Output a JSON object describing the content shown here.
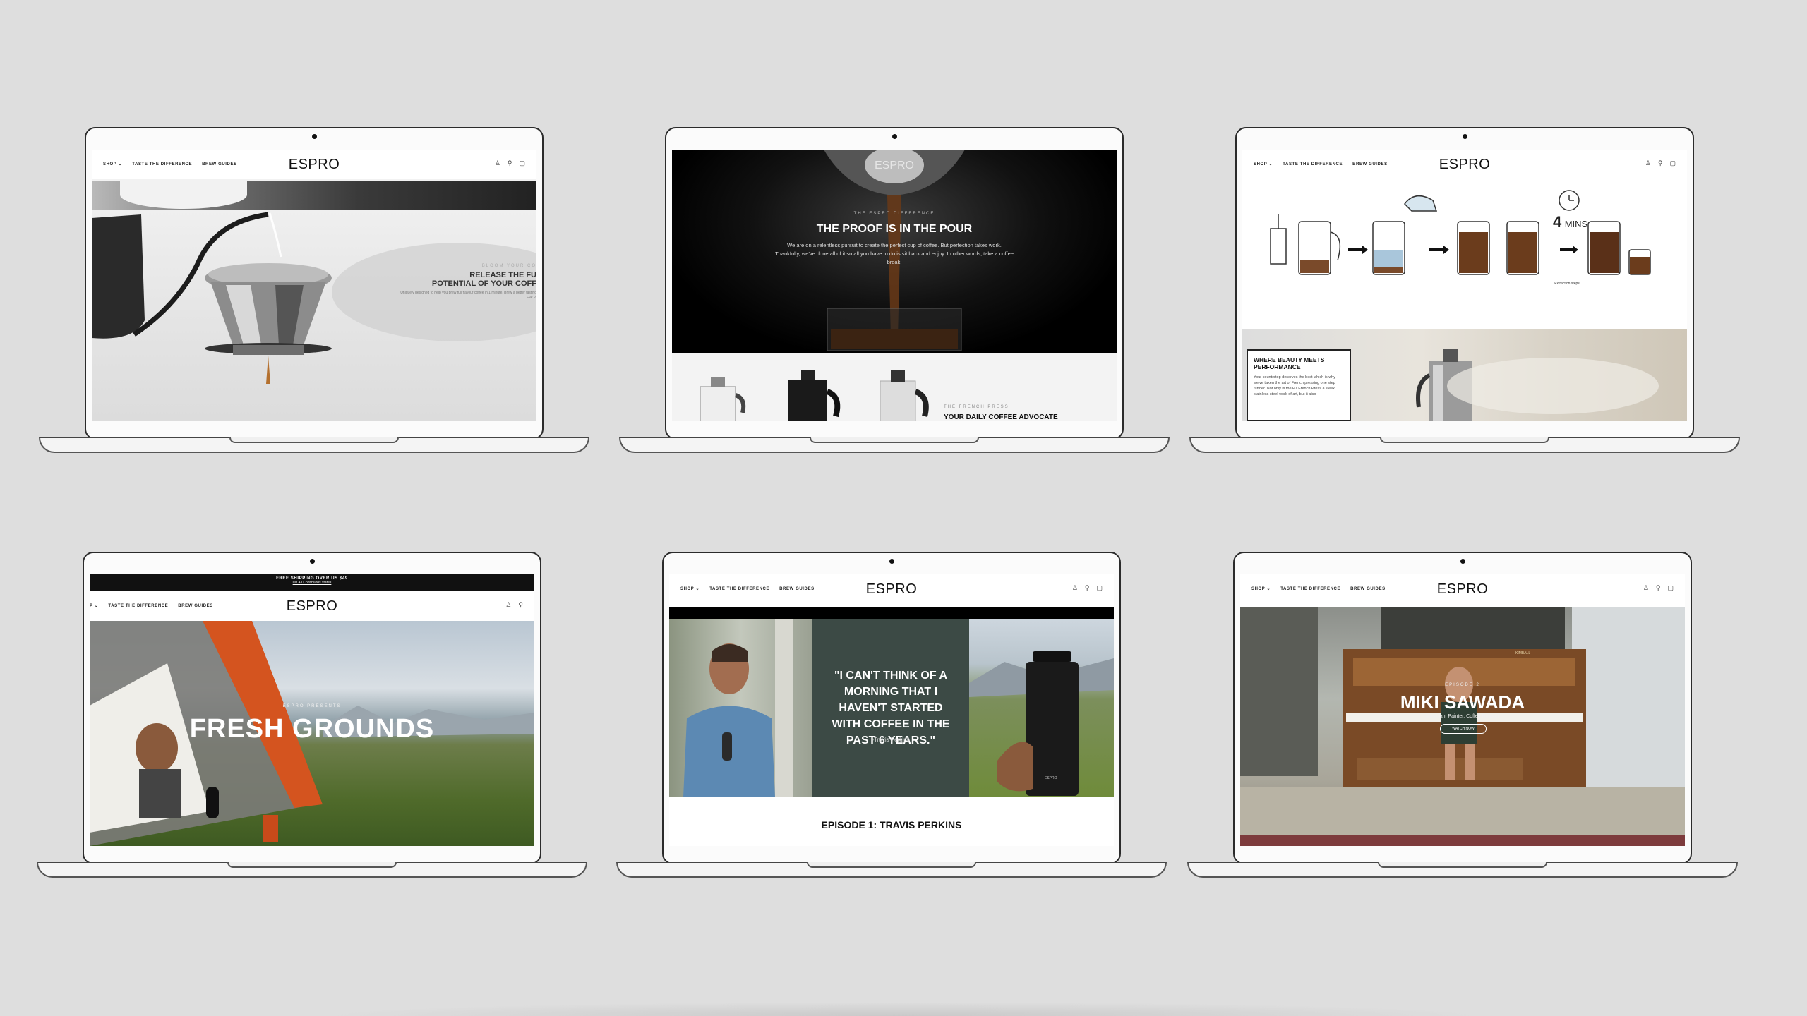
{
  "brand": "ESPRO",
  "nav": {
    "shop": "SHOP ⌄",
    "taste": "TASTE THE DIFFERENCE",
    "guides": "BREW GUIDES",
    "shop_cut": "P ⌄"
  },
  "icons": [
    "user-icon",
    "search-icon",
    "cart-icon"
  ],
  "screens": {
    "s1": {
      "kicker": "BLOOM YOUR CO",
      "headline_1": "RELEASE THE FU",
      "headline_2": "POTENTIAL OF YOUR COFF",
      "body": "Uniquely designed to help you brew full flavour coffee in 1 minute. Brew a better tasting cup of"
    },
    "s2": {
      "cap_logo": "ESPRO",
      "kicker": "THE ESPRO DIFFERENCE",
      "headline": "THE PROOF IS IN THE POUR",
      "body": "We are on a relentless pursuit to create the perfect cup of coffee. But perfection takes work. Thankfully, we've done all of it so all you have to do is sit back and enjoy. In other words, take a coffee break.",
      "sub_kicker": "THE FRENCH PRESS",
      "sub_headline": "YOUR DAILY COFFEE ADVOCATE"
    },
    "s3": {
      "timer_num": "4",
      "timer_unit": "MINS",
      "extraction": "Extraction steps",
      "card_title": "WHERE BEAUTY MEETS PERFORMANCE",
      "card_body": "Your countertop deserves the best which is why we've taken the art of French pressing one step further. Not only is the P7 French Press a sleek, stainless steel work of art, but it also"
    },
    "s4": {
      "banner_1": "FREE SHIPPING OVER US $49",
      "banner_2": "On All Continuous states",
      "kicker": "ESPRO PRESENTS",
      "headline": "FRESH GROUNDS"
    },
    "s5": {
      "quote": "\"I CAN'T THINK OF A MORNING THAT I HAVEN'T STARTED WITH COFFEE IN THE PAST 6 YEARS.\"",
      "author": "-Travis Perkins",
      "bottle_label": "ESPRO",
      "episode": "EPISODE 1: TRAVIS PERKINS"
    },
    "s6": {
      "kicker": "EPISODE 2",
      "headline": "MIKI SAWADA",
      "sub": "Musician, Painter, Coffee Roaster",
      "cta": "WATCH NOW",
      "piano_brand": "KIMBALL"
    }
  }
}
